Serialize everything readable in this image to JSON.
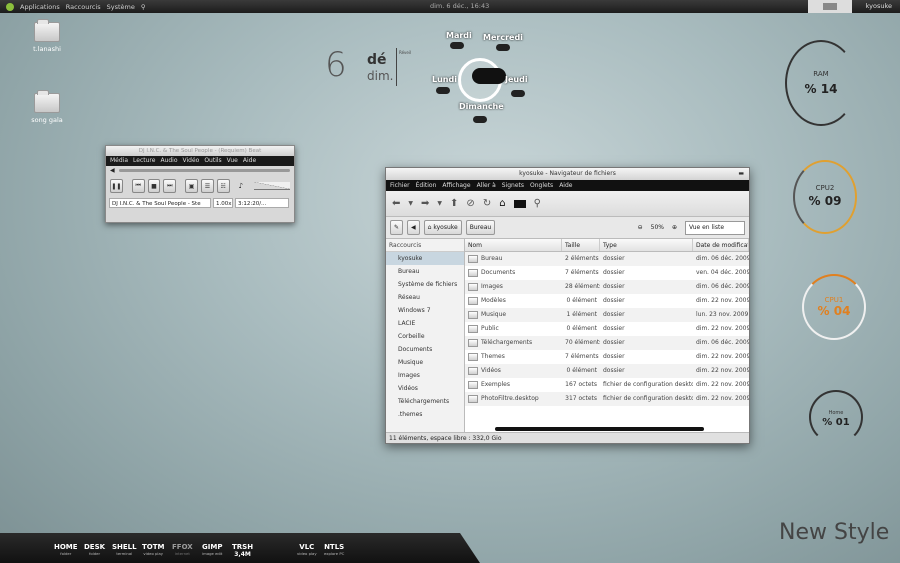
{
  "top_panel": {
    "menu": [
      "Applications",
      "Raccourcis",
      "Système"
    ],
    "clock": "dim. 6 déc., 16:43",
    "user": "kyosuke"
  },
  "desktop_icons": [
    {
      "label": "t.lanashi"
    },
    {
      "label": "song gala"
    }
  ],
  "calendar": {
    "day": "6",
    "month": "dé",
    "weekday": "dim.",
    "note": "Réveil"
  },
  "weather": {
    "days": [
      "Mardi",
      "Mercredi",
      "Lundi",
      "Jeudi",
      "Dimanche"
    ]
  },
  "gauges": [
    {
      "label": "RAM",
      "value": "% 14",
      "color": "#333333"
    },
    {
      "label": "CPU2",
      "value": "% 09",
      "color": "#e0a030"
    },
    {
      "label": "CPU1",
      "value": "% 04",
      "color": "#e08020"
    },
    {
      "label": "Home",
      "value": "% 01",
      "color": "#333333"
    }
  ],
  "player": {
    "title": "DJ I.N.C. & The Soul People - (Requiem) Beat",
    "menu": [
      "Média",
      "Lecture",
      "Audio",
      "Vidéo",
      "Outils",
      "Vue",
      "Aide"
    ],
    "track": "DJ I.N.C. & The Soul People - Ste",
    "rate": "1.00x",
    "time": "3:12:20/..."
  },
  "filemanager": {
    "title": "kyosuke - Navigateur de fichiers",
    "menu": [
      "Fichier",
      "Édition",
      "Affichage",
      "Aller à",
      "Signets",
      "Onglets",
      "Aide"
    ],
    "crumbs": [
      "kyosuke",
      "Bureau"
    ],
    "zoom": "50%",
    "view": "Vue en liste",
    "sidebar_head": "Raccourcis",
    "sidebar": [
      "kyosuke",
      "Bureau",
      "Système de fichiers",
      "Réseau",
      "Windows 7",
      "LACIE",
      "Corbeille",
      "Documents",
      "Musique",
      "Images",
      "Vidéos",
      "Téléchargements",
      ".themes"
    ],
    "columns": [
      "Nom",
      "Taille",
      "Type",
      "Date de modificati"
    ],
    "rows": [
      [
        "Bureau",
        "2 éléments",
        "dossier",
        "dim. 06 déc. 2009"
      ],
      [
        "Documents",
        "7 éléments",
        "dossier",
        "ven. 04 déc. 2009"
      ],
      [
        "Images",
        "28 éléments",
        "dossier",
        "dim. 06 déc. 2009"
      ],
      [
        "Modèles",
        "0 élément",
        "dossier",
        "dim. 22 nov. 2009"
      ],
      [
        "Musique",
        "1 élément",
        "dossier",
        "lun. 23 nov. 2009"
      ],
      [
        "Public",
        "0 élément",
        "dossier",
        "dim. 22 nov. 2009"
      ],
      [
        "Téléchargements",
        "70 éléments",
        "dossier",
        "dim. 06 déc. 2009"
      ],
      [
        "Themes",
        "7 éléments",
        "dossier",
        "dim. 22 nov. 2009"
      ],
      [
        "Vidéos",
        "0 élément",
        "dossier",
        "dim. 22 nov. 2009"
      ],
      [
        "Exemples",
        "167 octets",
        "fichier de configuration desktop",
        "dim. 22 nov. 2009"
      ],
      [
        "PhotoFiltre.desktop",
        "317 octets",
        "fichier de configuration desktop",
        "dim. 22 nov. 2009"
      ]
    ],
    "status": "11 éléments, espace libre : 332,0 Gio"
  },
  "dock": [
    {
      "label": "HOME",
      "sub": "folder"
    },
    {
      "label": "DESK",
      "sub": "folder"
    },
    {
      "label": "SHELL",
      "sub": "terminal"
    },
    {
      "label": "TOTM",
      "sub": "video play"
    },
    {
      "label": "FFOX",
      "sub": "internet"
    },
    {
      "label": "GIMP",
      "sub": "image edit"
    },
    {
      "label": "TRSH",
      "sub": "3,4M"
    },
    {
      "label": "VLC",
      "sub": "video play"
    },
    {
      "label": "NTLS",
      "sub": "explore PC"
    }
  ],
  "branding": "New Style"
}
